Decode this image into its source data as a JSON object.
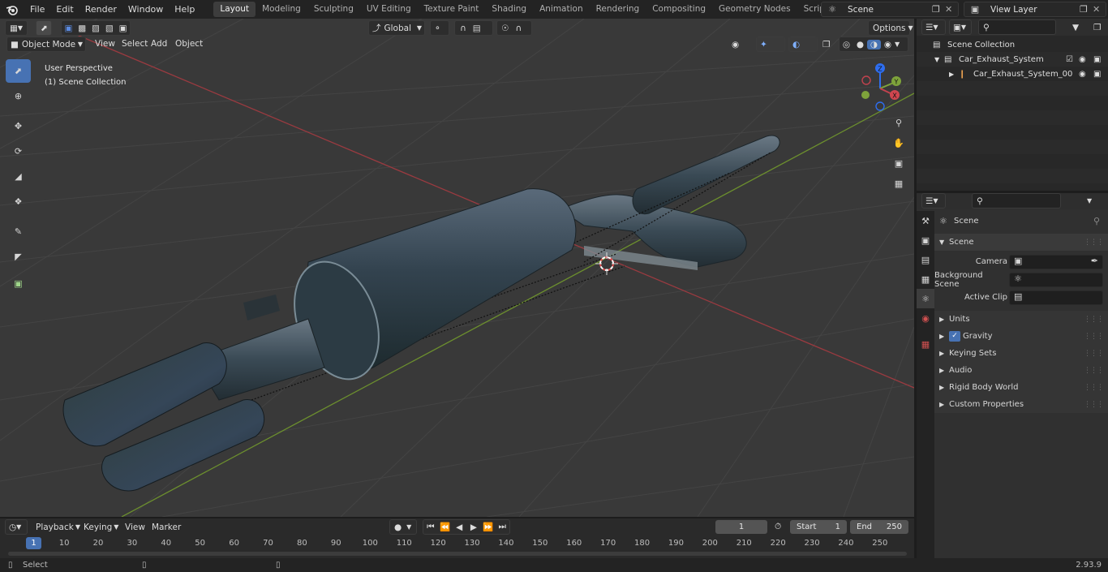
{
  "menubar": {
    "items": [
      "File",
      "Edit",
      "Render",
      "Window",
      "Help"
    ]
  },
  "workspaces": {
    "tabs": [
      "Layout",
      "Modeling",
      "Sculpting",
      "UV Editing",
      "Texture Paint",
      "Shading",
      "Animation",
      "Rendering",
      "Compositing",
      "Geometry Nodes",
      "Scripting"
    ],
    "active": "Layout",
    "add": "+"
  },
  "scene_selector": {
    "value": "Scene"
  },
  "viewlayer_selector": {
    "value": "View Layer"
  },
  "viewport": {
    "mode": "Object Mode",
    "menus": [
      "View",
      "Select",
      "Add",
      "Object"
    ],
    "transform_orientation": "Global",
    "options_label": "Options",
    "overlay_title": "User Perspective",
    "overlay_subtitle": "(1) Scene Collection",
    "gizmo_axes": [
      "Z",
      "Y",
      "X"
    ],
    "colors": {
      "x_axis": "#c1424e",
      "y_axis": "#7ea33b",
      "grid_bg": "#393939",
      "accent": "#4772b3"
    }
  },
  "timeline": {
    "menus": [
      "Playback",
      "Keying",
      "View",
      "Marker"
    ],
    "current_frame": "1",
    "start_label": "Start",
    "start_value": "1",
    "end_label": "End",
    "end_value": "250",
    "ruler_current": "1",
    "ruler_ticks": [
      "10",
      "20",
      "30",
      "40",
      "50",
      "60",
      "70",
      "80",
      "90",
      "100",
      "110",
      "120",
      "130",
      "140",
      "150",
      "160",
      "170",
      "180",
      "190",
      "200",
      "210",
      "220",
      "230",
      "240",
      "250"
    ]
  },
  "statusbar": {
    "select_label": "Select",
    "version": "2.93.9"
  },
  "outliner": {
    "root": "Scene Collection",
    "collection": "Car_Exhaust_System",
    "object": "Car_Exhaust_System_00"
  },
  "properties": {
    "context": "Scene",
    "panel_title": "Scene",
    "camera_label": "Camera",
    "background_scene_label": "Background Scene",
    "active_clip_label": "Active Clip",
    "sections": [
      "Units",
      "Gravity",
      "Keying Sets",
      "Audio",
      "Rigid Body World",
      "Custom Properties"
    ],
    "gravity_checked": true
  }
}
